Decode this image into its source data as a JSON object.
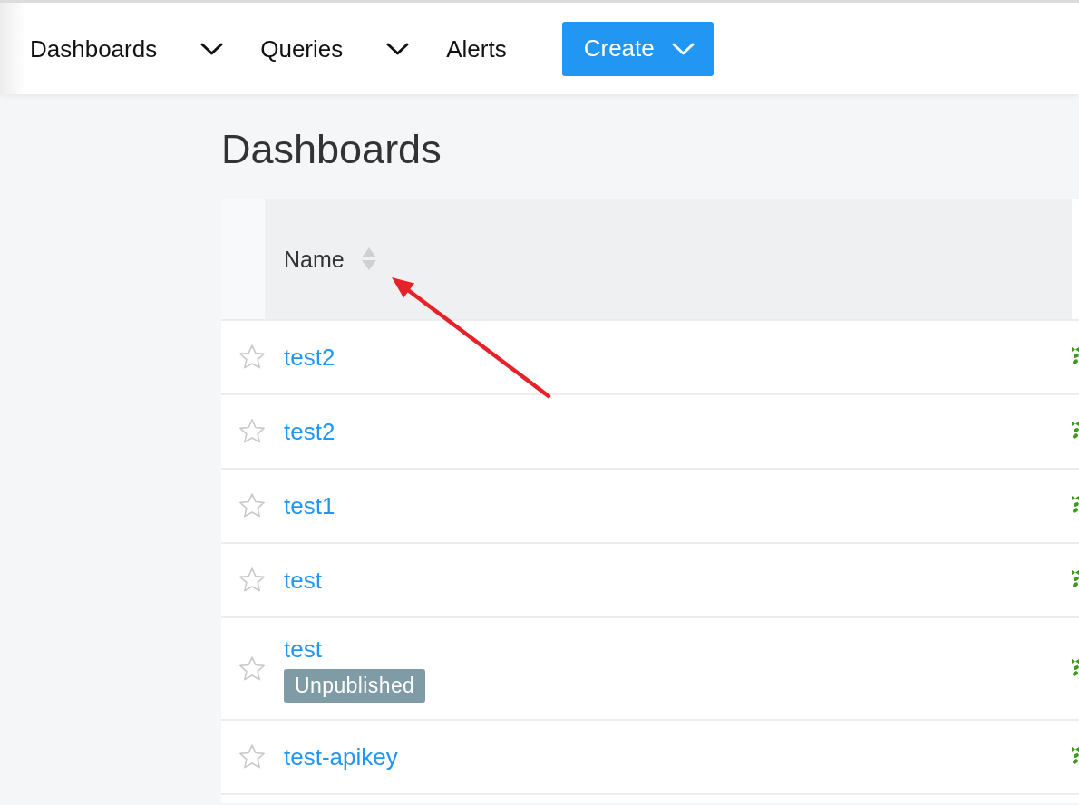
{
  "nav": {
    "items": [
      {
        "label": "Dashboards",
        "dropdown": true
      },
      {
        "label": "Queries",
        "dropdown": true
      },
      {
        "label": "Alerts",
        "dropdown": false
      }
    ],
    "create": {
      "label": "Create",
      "dropdown": true
    }
  },
  "page": {
    "title": "Dashboards"
  },
  "table": {
    "columns": [
      {
        "label": "Name",
        "sortable": true
      }
    ],
    "rows": [
      {
        "name": "test2",
        "favorite": false
      },
      {
        "name": "test2",
        "favorite": false
      },
      {
        "name": "test1",
        "favorite": false
      },
      {
        "name": "test",
        "favorite": false
      },
      {
        "name": "test",
        "favorite": false,
        "tag": "Unpublished"
      },
      {
        "name": "test-apikey",
        "favorite": false
      }
    ]
  }
}
